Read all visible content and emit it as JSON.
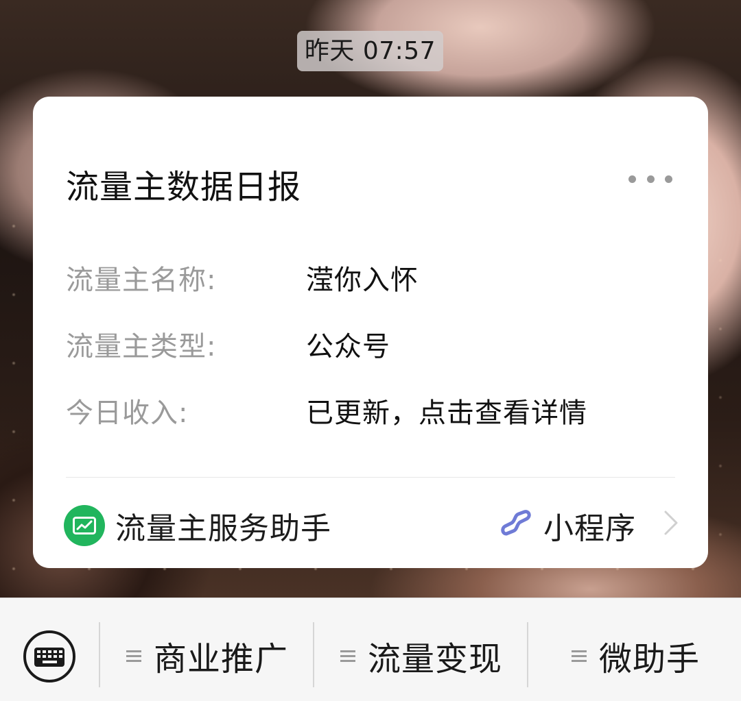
{
  "timestamp": "昨天 07:57",
  "card": {
    "title": "流量主数据日报",
    "rows": [
      {
        "label": "流量主名称:",
        "value": "滢你入怀"
      },
      {
        "label": "流量主类型:",
        "value": "公众号"
      },
      {
        "label": "今日收入:",
        "value": "已更新，点击查看详情"
      }
    ],
    "footer": {
      "app_name": "流量主服务助手",
      "app_icon": "chart-trend-icon",
      "mini_program_label": "小程序",
      "mini_program_icon": "mini-program-link-icon"
    }
  },
  "menubar": {
    "keyboard_icon": "keyboard-icon",
    "items": [
      {
        "label": "商业推广",
        "icon": "menu-list-icon"
      },
      {
        "label": "流量变现",
        "icon": "menu-list-icon"
      },
      {
        "label": "微助手",
        "icon": "menu-list-icon"
      }
    ]
  },
  "colors": {
    "app_icon_bg": "#21b55d",
    "mini_program_icon": "#6f7bd6",
    "label_gray": "#9a9a9a"
  }
}
